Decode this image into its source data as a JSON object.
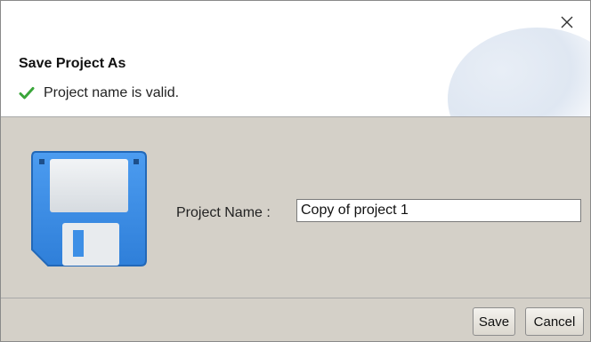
{
  "dialog": {
    "title": "Save Project As",
    "status_message": "Project name is valid.",
    "close_icon": "close-icon",
    "status_icon": "checkmark-icon",
    "status_color": "#3aa63a"
  },
  "form": {
    "project_name_label": "Project Name :",
    "project_name_value": "Copy of project 1",
    "disk_icon": "floppy-disk-icon"
  },
  "buttons": {
    "save_label": "Save",
    "cancel_label": "Cancel"
  },
  "colors": {
    "panel_bg": "#d4d0c8",
    "disk_blue": "#3d8fe6"
  }
}
